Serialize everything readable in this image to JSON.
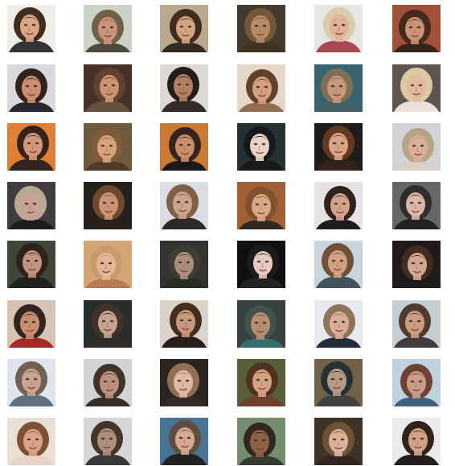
{
  "image": {
    "kind": "grid of generated face samples",
    "rows": 8,
    "cols": 6,
    "background_color": "#ffffff",
    "tiles": [
      {
        "bg": "#f0ece6",
        "hair": "#3a2418",
        "skin": "#d9a37e",
        "top": "#2c2c30"
      },
      {
        "bg": "#c8d2c4",
        "hair": "#6b5a3e",
        "skin": "#c98f75",
        "top": "#4a4238"
      },
      {
        "bg": "#b7a58a",
        "hair": "#3b2417",
        "skin": "#d3a07b",
        "top": "#2b201a"
      },
      {
        "bg": "#3e3424",
        "hair": "#6e5332",
        "skin": "#b38764",
        "top": "#3a2a18"
      },
      {
        "bg": "#e9e4e2",
        "hair": "#d8c9a8",
        "skin": "#dfad93",
        "top": "#a53f4a"
      },
      {
        "bg": "#9b4a2e",
        "hair": "#3e2213",
        "skin": "#c88f70",
        "top": "#2d1d12"
      },
      {
        "bg": "#d8d7de",
        "hair": "#2a1a13",
        "skin": "#c88a6d",
        "top": "#202028"
      },
      {
        "bg": "#3e2b22",
        "hair": "#5c3a26",
        "skin": "#c8906f",
        "top": "#5f4a3a"
      },
      {
        "bg": "#dcd7d3",
        "hair": "#1c1512",
        "skin": "#b07a5e",
        "top": "#2a2320"
      },
      {
        "bg": "#e3d6c6",
        "hair": "#5a3a22",
        "skin": "#d29e7b",
        "top": "#8f6a4a"
      },
      {
        "bg": "#2f5c6b",
        "hair": "#7c6a4e",
        "skin": "#c59379",
        "top": "#3d5a5f"
      },
      {
        "bg": "#5a4e4a",
        "hair": "#d9c8a0",
        "skin": "#e1b79c",
        "top": "#e8e1da"
      },
      {
        "bg": "#e07a2e",
        "hair": "#2d1a12",
        "skin": "#d09478",
        "top": "#2b1d18"
      },
      {
        "bg": "#6a5438",
        "hair": "#7b5530",
        "skin": "#d6a07a",
        "top": "#4a3420"
      },
      {
        "bg": "#c6752d",
        "hair": "#2e1b13",
        "skin": "#c98a66",
        "top": "#101010"
      },
      {
        "bg": "#1d2a2c",
        "hair": "#0f0f12",
        "skin": "#e9d2c6",
        "top": "#101010"
      },
      {
        "bg": "#171312",
        "hair": "#5b3218",
        "skin": "#d7a07f",
        "top": "#2a1a14"
      },
      {
        "bg": "#d2d2d6",
        "hair": "#b59f86",
        "skin": "#d8ad93",
        "top": "#d6cfc8"
      },
      {
        "bg": "#3a3538",
        "hair": "#b7a690",
        "skin": "#c69f90",
        "top": "#141416"
      },
      {
        "bg": "#1e1714",
        "hair": "#6a4128",
        "skin": "#c9906f",
        "top": "#221813"
      },
      {
        "bg": "#d9dde3",
        "hair": "#7b5a40",
        "skin": "#caa08a",
        "top": "#25211f"
      },
      {
        "bg": "#9f5a2e",
        "hair": "#7a4a27",
        "skin": "#d8a582",
        "top": "#2a1f1a"
      },
      {
        "bg": "#e6e2e4",
        "hair": "#2a1a12",
        "skin": "#d2a088",
        "top": "#151414"
      },
      {
        "bg": "#5e6362",
        "hair": "#2a2522",
        "skin": "#d9b4a6",
        "top": "#1b1a1b"
      },
      {
        "bg": "#384033",
        "hair": "#261912",
        "skin": "#c08f79",
        "top": "#1a1715"
      },
      {
        "bg": "#d5a270",
        "hair": "#c49a64",
        "skin": "#e2b494",
        "top": "#b5754f"
      },
      {
        "bg": "#2c2b28",
        "hair": "#36352e",
        "skin": "#a98a77",
        "top": "#1f241f"
      },
      {
        "bg": "#070707",
        "hair": "#121212",
        "skin": "#e4c9bd",
        "top": "#1a1a1a"
      },
      {
        "bg": "#c7d4dc",
        "hair": "#6b4a30",
        "skin": "#cf9e80",
        "top": "#3b4d58"
      },
      {
        "bg": "#171210",
        "hair": "#3a2418",
        "skin": "#d0a38f",
        "top": "#151215"
      },
      {
        "bg": "#d4c2b4",
        "hair": "#2a1c17",
        "skin": "#c58a6c",
        "top": "#a42020"
      },
      {
        "bg": "#1f2522",
        "hair": "#3a2a20",
        "skin": "#c3a08c",
        "top": "#2a2422"
      },
      {
        "bg": "#dad2c8",
        "hair": "#3d2619",
        "skin": "#c79376",
        "top": "#1f1612"
      },
      {
        "bg": "#2f3a3a",
        "hair": "#3b4a42",
        "skin": "#b48a6c",
        "top": "#2c6a6a"
      },
      {
        "bg": "#e8e9ee",
        "hair": "#8a6e54",
        "skin": "#d8ab92",
        "top": "#1a2330"
      },
      {
        "bg": "#c3ccd2",
        "hair": "#4a3226",
        "skin": "#c8987c",
        "top": "#3a3436"
      },
      {
        "bg": "#dde3ea",
        "hair": "#6a5a4d",
        "skin": "#c9a18c",
        "top": "#5a6a7a"
      },
      {
        "bg": "#cfd3d5",
        "hair": "#3a2a22",
        "skin": "#b98e78",
        "top": "#2c2624"
      },
      {
        "bg": "#231c18",
        "hair": "#8c6a4c",
        "skin": "#dfb79f",
        "top": "#2b2320"
      },
      {
        "bg": "#4f5a32",
        "hair": "#4a2a1a",
        "skin": "#d0a07e",
        "top": "#6a3a24"
      },
      {
        "bg": "#6c5c40",
        "hair": "#1d2a2c",
        "skin": "#b59682",
        "top": "#3a3a3a"
      },
      {
        "bg": "#bdd1e0",
        "hair": "#6a3a2a",
        "skin": "#c69a86",
        "top": "#3a5a7a"
      },
      {
        "bg": "#e8dfd3",
        "hair": "#7a4a2a",
        "skin": "#d7a286",
        "top": "#e8d2c2"
      },
      {
        "bg": "#d4d5d8",
        "hair": "#3d2c22",
        "skin": "#a98c78",
        "top": "#333030"
      },
      {
        "bg": "#3f6f91",
        "hair": "#5a4636",
        "skin": "#d3a68c",
        "top": "#1a1a1a"
      },
      {
        "bg": "#6f8a68",
        "hair": "#2a1e18",
        "skin": "#8a5b42",
        "top": "#2c3328"
      },
      {
        "bg": "#3a2a20",
        "hair": "#6a4a2e",
        "skin": "#d8b094",
        "top": "#2b1e15"
      },
      {
        "bg": "#e9ebee",
        "hair": "#2a1a14",
        "skin": "#d2a085",
        "top": "#1a1515"
      }
    ]
  }
}
